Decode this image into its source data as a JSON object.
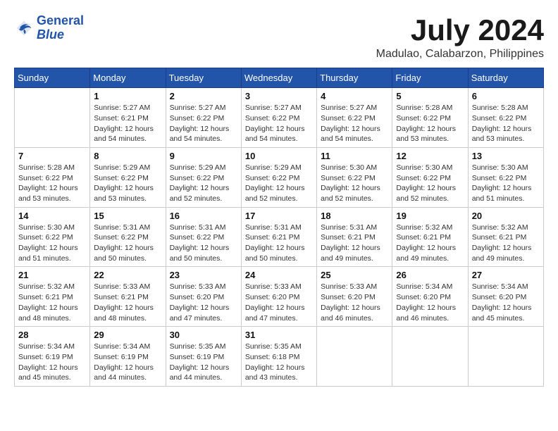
{
  "header": {
    "logo_line1": "General",
    "logo_line2": "Blue",
    "month": "July 2024",
    "location": "Madulao, Calabarzon, Philippines"
  },
  "weekdays": [
    "Sunday",
    "Monday",
    "Tuesday",
    "Wednesday",
    "Thursday",
    "Friday",
    "Saturday"
  ],
  "weeks": [
    [
      {
        "day": "",
        "info": ""
      },
      {
        "day": "1",
        "info": "Sunrise: 5:27 AM\nSunset: 6:21 PM\nDaylight: 12 hours\nand 54 minutes."
      },
      {
        "day": "2",
        "info": "Sunrise: 5:27 AM\nSunset: 6:22 PM\nDaylight: 12 hours\nand 54 minutes."
      },
      {
        "day": "3",
        "info": "Sunrise: 5:27 AM\nSunset: 6:22 PM\nDaylight: 12 hours\nand 54 minutes."
      },
      {
        "day": "4",
        "info": "Sunrise: 5:27 AM\nSunset: 6:22 PM\nDaylight: 12 hours\nand 54 minutes."
      },
      {
        "day": "5",
        "info": "Sunrise: 5:28 AM\nSunset: 6:22 PM\nDaylight: 12 hours\nand 53 minutes."
      },
      {
        "day": "6",
        "info": "Sunrise: 5:28 AM\nSunset: 6:22 PM\nDaylight: 12 hours\nand 53 minutes."
      }
    ],
    [
      {
        "day": "7",
        "info": "Sunrise: 5:28 AM\nSunset: 6:22 PM\nDaylight: 12 hours\nand 53 minutes."
      },
      {
        "day": "8",
        "info": "Sunrise: 5:29 AM\nSunset: 6:22 PM\nDaylight: 12 hours\nand 53 minutes."
      },
      {
        "day": "9",
        "info": "Sunrise: 5:29 AM\nSunset: 6:22 PM\nDaylight: 12 hours\nand 52 minutes."
      },
      {
        "day": "10",
        "info": "Sunrise: 5:29 AM\nSunset: 6:22 PM\nDaylight: 12 hours\nand 52 minutes."
      },
      {
        "day": "11",
        "info": "Sunrise: 5:30 AM\nSunset: 6:22 PM\nDaylight: 12 hours\nand 52 minutes."
      },
      {
        "day": "12",
        "info": "Sunrise: 5:30 AM\nSunset: 6:22 PM\nDaylight: 12 hours\nand 52 minutes."
      },
      {
        "day": "13",
        "info": "Sunrise: 5:30 AM\nSunset: 6:22 PM\nDaylight: 12 hours\nand 51 minutes."
      }
    ],
    [
      {
        "day": "14",
        "info": "Sunrise: 5:30 AM\nSunset: 6:22 PM\nDaylight: 12 hours\nand 51 minutes."
      },
      {
        "day": "15",
        "info": "Sunrise: 5:31 AM\nSunset: 6:22 PM\nDaylight: 12 hours\nand 50 minutes."
      },
      {
        "day": "16",
        "info": "Sunrise: 5:31 AM\nSunset: 6:22 PM\nDaylight: 12 hours\nand 50 minutes."
      },
      {
        "day": "17",
        "info": "Sunrise: 5:31 AM\nSunset: 6:21 PM\nDaylight: 12 hours\nand 50 minutes."
      },
      {
        "day": "18",
        "info": "Sunrise: 5:31 AM\nSunset: 6:21 PM\nDaylight: 12 hours\nand 49 minutes."
      },
      {
        "day": "19",
        "info": "Sunrise: 5:32 AM\nSunset: 6:21 PM\nDaylight: 12 hours\nand 49 minutes."
      },
      {
        "day": "20",
        "info": "Sunrise: 5:32 AM\nSunset: 6:21 PM\nDaylight: 12 hours\nand 49 minutes."
      }
    ],
    [
      {
        "day": "21",
        "info": "Sunrise: 5:32 AM\nSunset: 6:21 PM\nDaylight: 12 hours\nand 48 minutes."
      },
      {
        "day": "22",
        "info": "Sunrise: 5:33 AM\nSunset: 6:21 PM\nDaylight: 12 hours\nand 48 minutes."
      },
      {
        "day": "23",
        "info": "Sunrise: 5:33 AM\nSunset: 6:20 PM\nDaylight: 12 hours\nand 47 minutes."
      },
      {
        "day": "24",
        "info": "Sunrise: 5:33 AM\nSunset: 6:20 PM\nDaylight: 12 hours\nand 47 minutes."
      },
      {
        "day": "25",
        "info": "Sunrise: 5:33 AM\nSunset: 6:20 PM\nDaylight: 12 hours\nand 46 minutes."
      },
      {
        "day": "26",
        "info": "Sunrise: 5:34 AM\nSunset: 6:20 PM\nDaylight: 12 hours\nand 46 minutes."
      },
      {
        "day": "27",
        "info": "Sunrise: 5:34 AM\nSunset: 6:20 PM\nDaylight: 12 hours\nand 45 minutes."
      }
    ],
    [
      {
        "day": "28",
        "info": "Sunrise: 5:34 AM\nSunset: 6:19 PM\nDaylight: 12 hours\nand 45 minutes."
      },
      {
        "day": "29",
        "info": "Sunrise: 5:34 AM\nSunset: 6:19 PM\nDaylight: 12 hours\nand 44 minutes."
      },
      {
        "day": "30",
        "info": "Sunrise: 5:35 AM\nSunset: 6:19 PM\nDaylight: 12 hours\nand 44 minutes."
      },
      {
        "day": "31",
        "info": "Sunrise: 5:35 AM\nSunset: 6:18 PM\nDaylight: 12 hours\nand 43 minutes."
      },
      {
        "day": "",
        "info": ""
      },
      {
        "day": "",
        "info": ""
      },
      {
        "day": "",
        "info": ""
      }
    ]
  ]
}
